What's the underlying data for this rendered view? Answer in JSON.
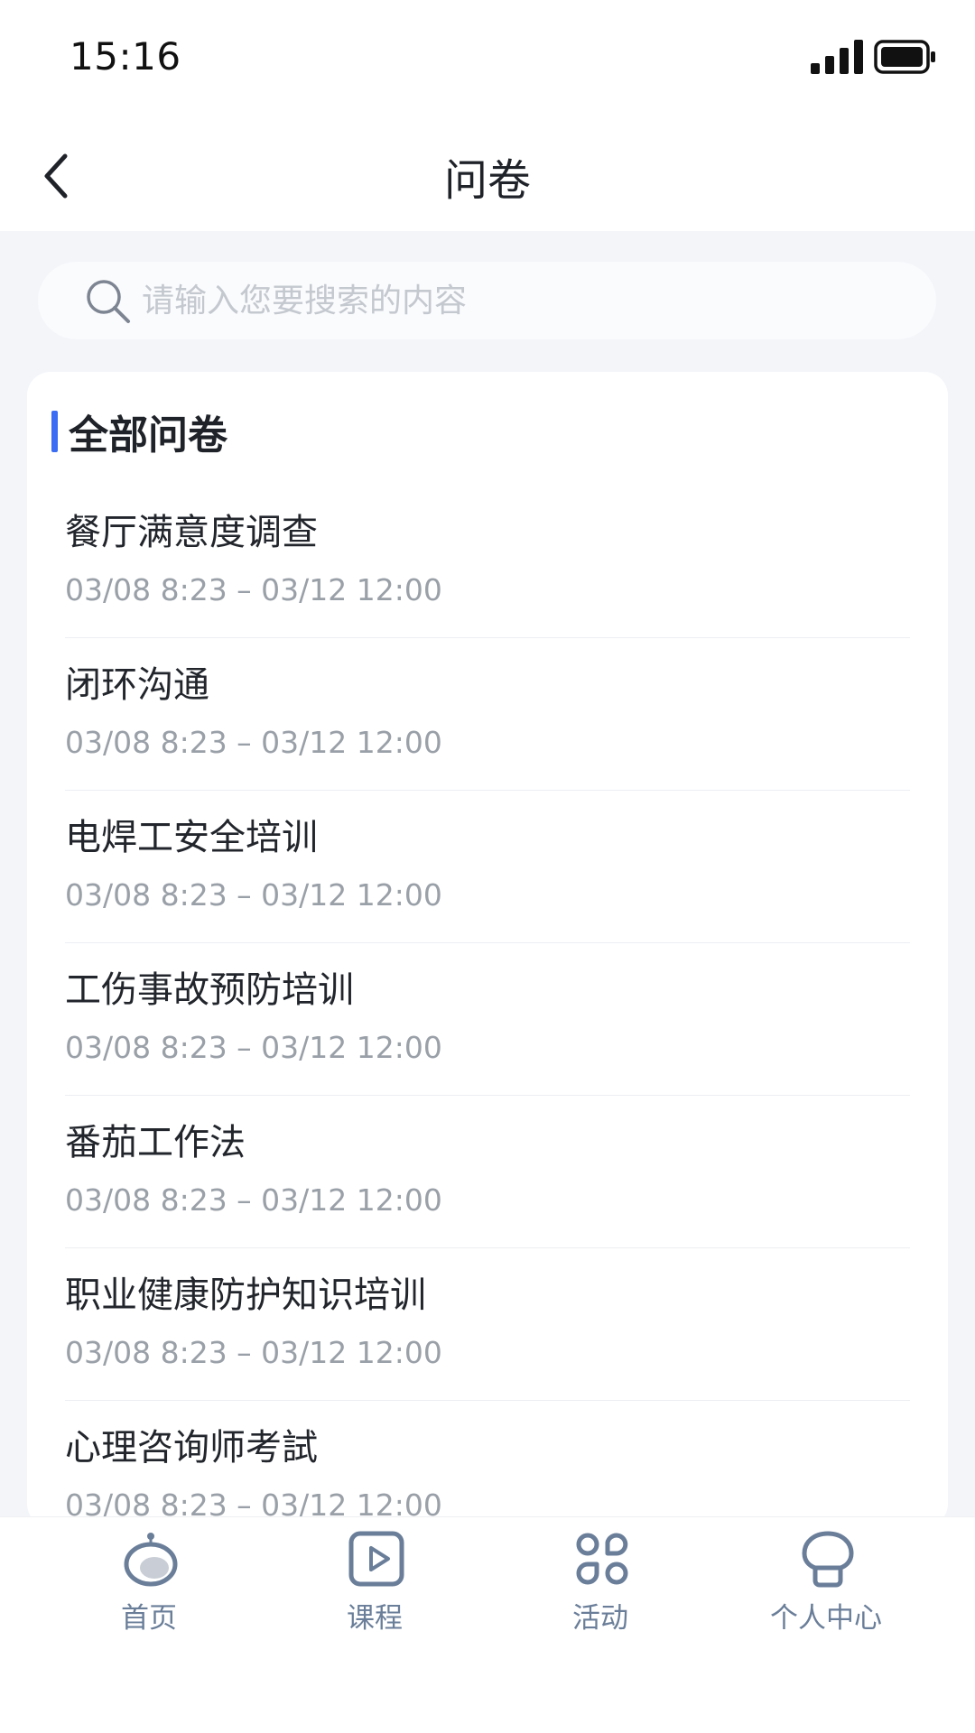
{
  "status_bar": {
    "time": "15:16"
  },
  "nav": {
    "title": "问卷"
  },
  "search": {
    "placeholder": "请输入您要搜索的内容"
  },
  "section": {
    "title": "全部问卷"
  },
  "surveys": [
    {
      "title": "餐厅满意度调查",
      "time": "03/08 8:23 – 03/12 12:00"
    },
    {
      "title": "闭环沟通",
      "time": "03/08 8:23 – 03/12 12:00"
    },
    {
      "title": "电焊工安全培训",
      "time": "03/08 8:23 – 03/12 12:00"
    },
    {
      "title": "工伤事故预防培训",
      "time": "03/08 8:23 – 03/12 12:00"
    },
    {
      "title": "番茄工作法",
      "time": "03/08 8:23 – 03/12 12:00"
    },
    {
      "title": "职业健康防护知识培训",
      "time": "03/08 8:23 – 03/12 12:00"
    },
    {
      "title": "心理咨询师考試",
      "time": "03/08 8:23 – 03/12 12:00"
    }
  ],
  "tabs": [
    {
      "label": "首页",
      "icon": "home-robot-icon"
    },
    {
      "label": "课程",
      "icon": "play-course-icon"
    },
    {
      "label": "活动",
      "icon": "activity-grid-icon"
    },
    {
      "label": "个人中心",
      "icon": "profile-icon"
    }
  ],
  "colors": {
    "accent": "#3a6cf4",
    "tab_icon": "#6a7e99",
    "background": "#f3f5f9"
  }
}
